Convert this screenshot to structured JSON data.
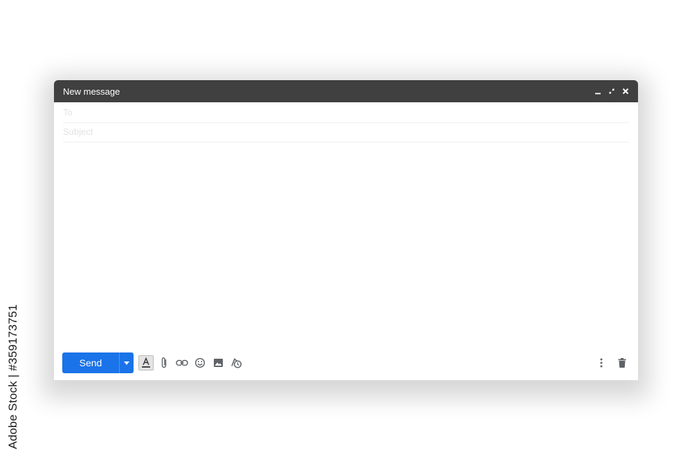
{
  "window": {
    "title": "New message",
    "controls": [
      "minimize-icon",
      "exit-fullscreen-icon",
      "close-icon"
    ]
  },
  "fields": {
    "to_placeholder": "To",
    "subject_placeholder": "Subject"
  },
  "toolbar": {
    "send_label": "Send",
    "tools": [
      "formatting-icon",
      "attach-icon",
      "link-icon",
      "emoji-icon",
      "photo-icon",
      "schedule-icon"
    ],
    "right_tools": [
      "more-options-icon",
      "trash-icon"
    ]
  },
  "credit": {
    "text": "Adobe Stock | #359173751"
  },
  "colors": {
    "titlebar": "#404040",
    "send": "#1a73e8",
    "icons": "#5f6368"
  }
}
